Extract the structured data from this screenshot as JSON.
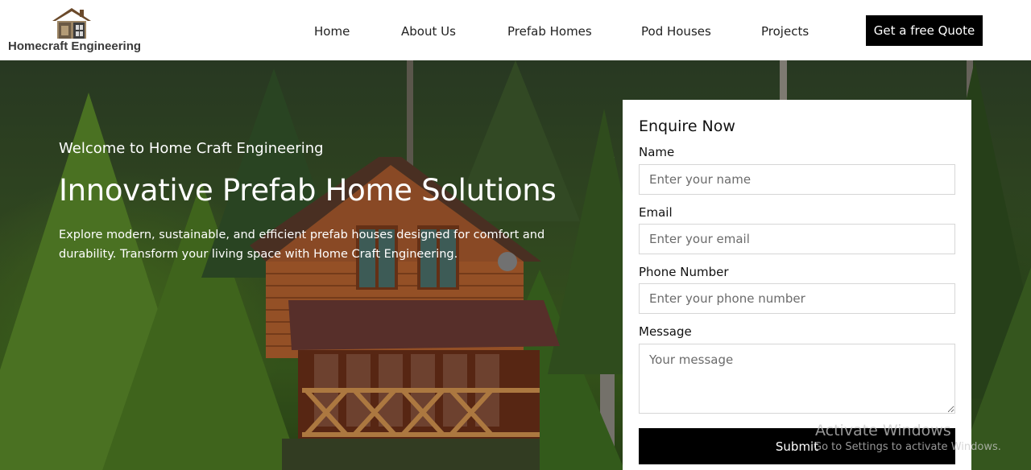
{
  "brand": {
    "name": "Homecraft Engineering",
    "logo_icon": "house-logo-icon"
  },
  "nav": {
    "links": [
      {
        "label": "Home"
      },
      {
        "label": "About Us"
      },
      {
        "label": "Prefab Homes"
      },
      {
        "label": "Pod Houses"
      },
      {
        "label": "Projects"
      }
    ],
    "cta_label": "Get a free Quote"
  },
  "hero": {
    "subtitle": "Welcome to Home Craft Engineering",
    "title": "Innovative Prefab Home Solutions",
    "description": "Explore modern, sustainable, and efficient prefab houses designed for comfort and durability. Transform your living space with Home Craft Engineering."
  },
  "form": {
    "title": "Enquire Now",
    "name_label": "Name",
    "name_placeholder": "Enter your name",
    "email_label": "Email",
    "email_placeholder": "Enter your email",
    "phone_label": "Phone Number",
    "phone_placeholder": "Enter your phone number",
    "message_label": "Message",
    "message_placeholder": "Your message",
    "submit_label": "Submit"
  },
  "watermark": {
    "title": "Activate Windows",
    "subtitle": "Go to Settings to activate Windows."
  },
  "colors": {
    "primary_button": "#000000",
    "nav_background": "#ffffff",
    "form_background": "#ffffff",
    "hero_text": "#ffffff"
  }
}
